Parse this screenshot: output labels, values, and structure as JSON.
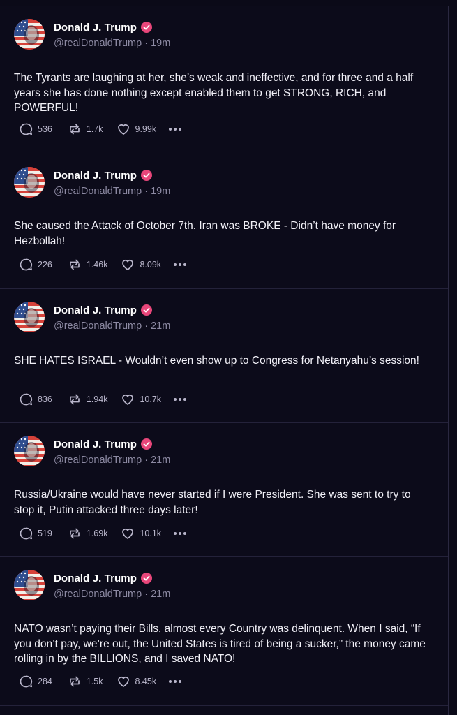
{
  "author": {
    "display_name": "Donald J. Trump",
    "handle": "@realDonaldTrump",
    "verified_badge_color": "#e8467a",
    "avatar_icon": "flag-portrait-avatar"
  },
  "colors": {
    "background": "#0c0b1a",
    "text": "#f1f0f7",
    "muted": "#8d8aa3",
    "divider": "#24223a"
  },
  "posts": [
    {
      "meta": "@realDonaldTrump · 19m",
      "text": "The Tyrants are laughing at her, she’s weak and ineffective, and for three and a half years she has done nothing except enabled them to get STRONG, RICH, and POWERFUL!",
      "replies": "536",
      "retruths": "1.7k",
      "likes": "9.99k"
    },
    {
      "meta": "@realDonaldTrump · 19m",
      "text": "She caused the Attack of October 7th. Iran was BROKE - Didn’t have money for Hezbollah!",
      "replies": "226",
      "retruths": "1.46k",
      "likes": "8.09k"
    },
    {
      "meta": "@realDonaldTrump · 21m",
      "text": "SHE HATES ISRAEL - Wouldn’t even show up to Congress for Netanyahu’s session!",
      "replies": "836",
      "retruths": "1.94k",
      "likes": "10.7k"
    },
    {
      "meta": "@realDonaldTrump · 21m",
      "text": "Russia/Ukraine would have never started if I were President. She was sent to try to stop it, Putin attacked three days later!",
      "replies": "519",
      "retruths": "1.69k",
      "likes": "10.1k"
    },
    {
      "meta": "@realDonaldTrump · 21m",
      "text": "NATO wasn’t paying their Bills, almost every Country was delinquent. When I said, “If you don’t pay, we’re out, the United States is tired of being a sucker,” the money came rolling in by the BILLIONS, and I saved NATO!",
      "replies": "284",
      "retruths": "1.5k",
      "likes": "8.45k"
    }
  ]
}
